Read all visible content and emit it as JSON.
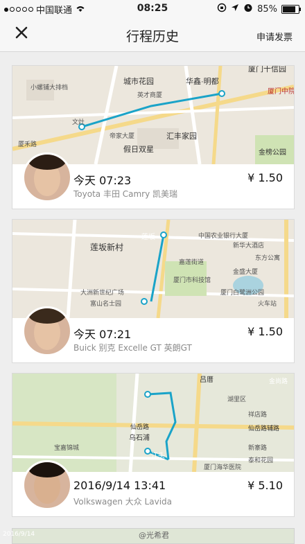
{
  "status_bar": {
    "carrier": "中国联通",
    "time": "08:25",
    "battery": "85%"
  },
  "nav": {
    "close": "✕",
    "title": "行程历史",
    "invoice": "申请发票"
  },
  "trips": [
    {
      "time": "今天 07:23",
      "car": "Toyota 丰田 Camry 凯美瑞",
      "price": "¥ 1.50",
      "map_labels": [
        "城市花园",
        "华鑫·明都",
        "厦门十信园",
        "小螺铺大排档",
        "英才商厦",
        "厦门中院金线",
        "帝家大厦",
        "汇丰家园",
        "假日双星",
        "金榜公园",
        "厦禾路",
        "文灶"
      ]
    },
    {
      "time": "今天 07:21",
      "car": "Buick 别克 Excelle GT 英朗GT",
      "price": "¥ 1.50",
      "map_labels": [
        "莲坂新村",
        "莲坂",
        "中国农业银行大厦",
        "新华大酒店",
        "东方公寓",
        "大洲新世纪广场",
        "富山名士园",
        "厦门市科技馆",
        "嘉莲街道",
        "厦门白鹭洲公园",
        "火车站",
        "金盛大厦"
      ]
    },
    {
      "time": "2016/9/14 13:41",
      "car": "Volkswagen 大众 Lavida",
      "price": "¥ 5.10",
      "map_labels": [
        "吕厝",
        "金尚路",
        "乌石浦",
        "江头",
        "仙岳路",
        "仙岳路辅路",
        "新寨路",
        "宝嘉锦城",
        "湖里区",
        "祥店路",
        "泰和花园",
        "厦门海华医院"
      ]
    }
  ],
  "watermark": "@光希君",
  "watermark_small": "2016/9/14"
}
